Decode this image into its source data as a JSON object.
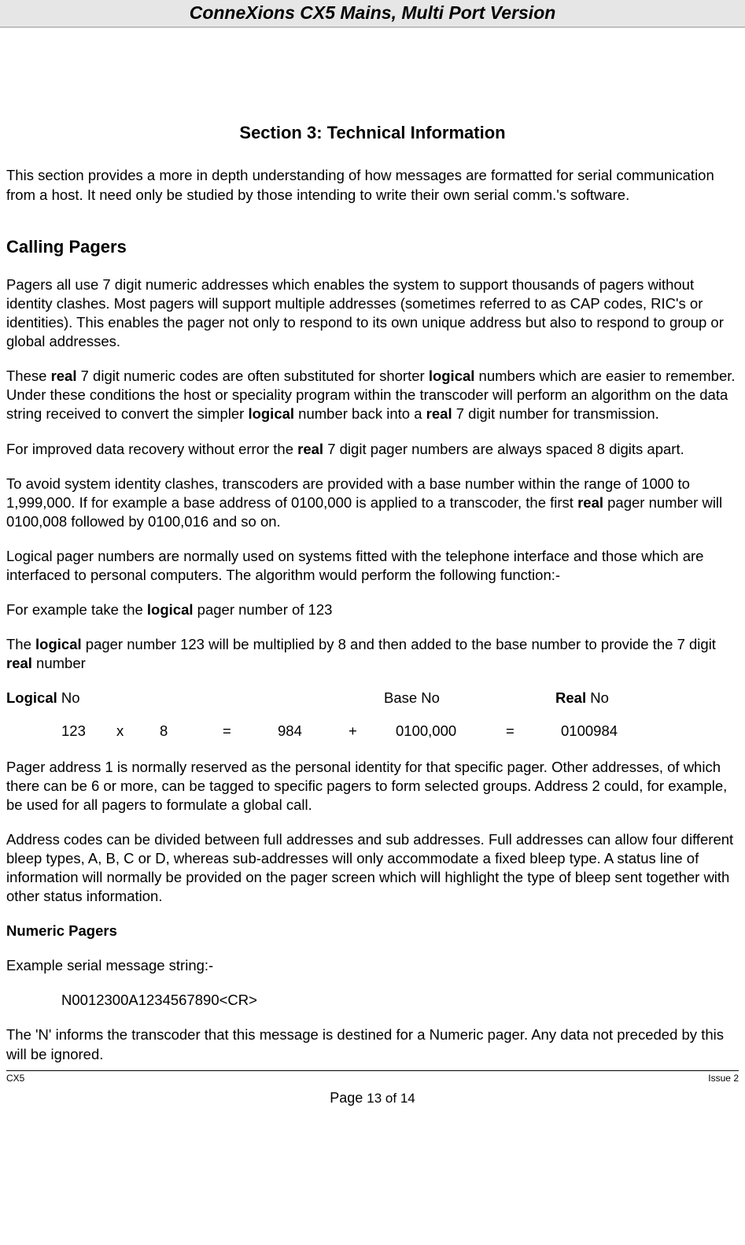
{
  "header": {
    "title": "ConneXions CX5   Mains, Multi Port Version"
  },
  "section": {
    "title": "Section 3: Technical Information",
    "intro": "This section provides a more in depth understanding of how messages are formatted for serial communication from a host. It need only be studied by those intending to write their own serial comm.'s software."
  },
  "calling": {
    "heading": "Calling Pagers",
    "p1": "Pagers all use 7 digit numeric addresses which enables the system to support thousands of pagers without identity clashes. Most pagers will support multiple addresses (sometimes referred to as CAP codes, RIC's or identities). This enables the pager not only to respond to its own unique address but also to respond to group or global addresses.",
    "p2a": "These ",
    "p2b": "real",
    "p2c": " 7 digit numeric codes are often substituted for shorter ",
    "p2d": "logical",
    "p2e": " numbers which are easier to remember. Under these conditions the host or speciality program within the transcoder will perform an algorithm on the data string received to convert the simpler ",
    "p2f": "logical",
    "p2g": " number back into a ",
    "p2h": "real",
    "p2i": " 7 digit number for transmission.",
    "p3a": "For improved data recovery without error the ",
    "p3b": "real",
    "p3c": " 7 digit pager numbers are always spaced 8 digits apart.",
    "p4a": "To avoid system identity clashes, transcoders are provided with a base number within the range of 1000 to 1,999,000.  If for example a base address of 0100,000 is applied to a transcoder, the first ",
    "p4b": "real",
    "p4c": " pager number will 0100,008 followed by 0100,016 and so on.",
    "p5": "Logical pager numbers are normally used on systems fitted with the telephone interface and those which are interfaced to personal computers. The algorithm would perform the following function:-",
    "p6a": "For example take the ",
    "p6b": "logical",
    "p6c": " pager number of 123",
    "p7a": "The ",
    "p7b": "logical",
    "p7c": " pager number 123 will be multiplied by 8 and then added to the base number to provide the 7 digit ",
    "p7d": "real",
    "p7e": " number"
  },
  "calc": {
    "h_logical_b": "Logical",
    "h_logical_t": " No",
    "h_base": "Base No",
    "h_real_b": "Real",
    "h_real_t": " No",
    "v1": "123",
    "v2": "x",
    "v3": "8",
    "v4": "=",
    "v5": "984",
    "v6": "+",
    "v7": "0100,000",
    "v8": "=",
    "v9": "0100984"
  },
  "after": {
    "p1": "Pager address 1 is normally reserved as the personal identity for that specific pager.  Other addresses, of which there can be 6 or more, can be tagged to specific pagers to form selected groups.  Address 2 could, for example, be used for all pagers to formulate a global call.",
    "p2": "Address codes can be divided between full addresses and sub addresses. Full addresses can allow four different bleep types, A, B, C or D, whereas sub-addresses will only accommodate a fixed bleep type. A status line of information will normally be provided on the pager screen which will highlight the type of bleep sent together with other status information."
  },
  "numeric": {
    "heading": "Numeric Pagers",
    "p1": "Example serial message string:-",
    "code": "N0012300A1234567890<CR>",
    "p2": "The 'N' informs the transcoder that this message is destined for a Numeric pager.  Any data not preceded by this will be ignored."
  },
  "footer": {
    "left": "CX5",
    "right": "Issue 2",
    "page_label": "Page ",
    "page_val": "13 of 14"
  }
}
